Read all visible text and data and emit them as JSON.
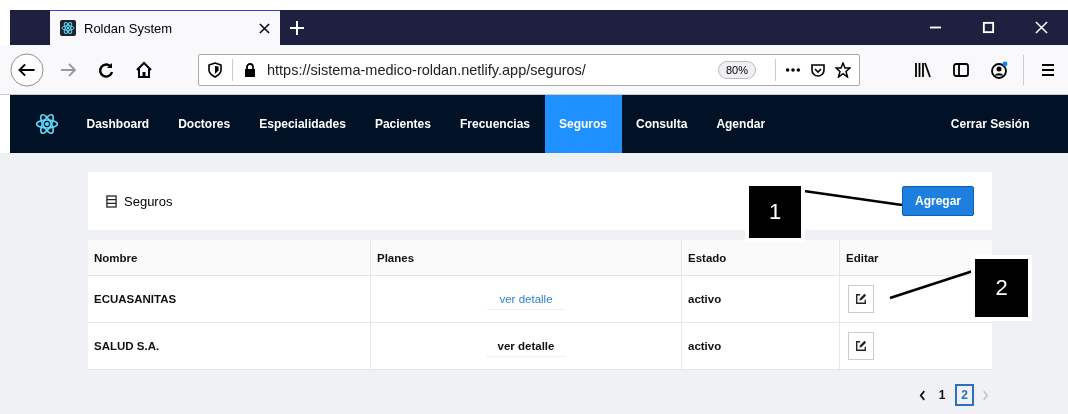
{
  "browser": {
    "tab_title": "Roldan System",
    "url": "https://sistema-medico-roldan.netlify.app/seguros/",
    "zoom": "80%"
  },
  "nav": {
    "items": [
      {
        "label": "Dashboard",
        "selected": false
      },
      {
        "label": "Doctores",
        "selected": false
      },
      {
        "label": "Especialidades",
        "selected": false
      },
      {
        "label": "Pacientes",
        "selected": false
      },
      {
        "label": "Frecuencias",
        "selected": false
      },
      {
        "label": "Seguros",
        "selected": true
      },
      {
        "label": "Consulta",
        "selected": false
      },
      {
        "label": "Agendar",
        "selected": false
      }
    ],
    "logout": "Cerrar Sesión"
  },
  "header": {
    "title": "Seguros",
    "add_button": "Agregar"
  },
  "table": {
    "columns": [
      "Nombre",
      "Planes",
      "Estado",
      "Editar"
    ],
    "rows": [
      {
        "nombre": "ECUASANITAS",
        "planes": "ver detalle",
        "highlighted": true,
        "estado": "activo"
      },
      {
        "nombre": "SALUD S.A.",
        "planes": "ver detalle",
        "highlighted": false,
        "estado": "activo"
      }
    ]
  },
  "pagination": {
    "pages": [
      {
        "label": "1",
        "selected": false
      },
      {
        "label": "2",
        "selected": true
      }
    ],
    "next_disabled": true
  },
  "annotations": [
    {
      "label": "1"
    },
    {
      "label": "2"
    }
  ]
}
